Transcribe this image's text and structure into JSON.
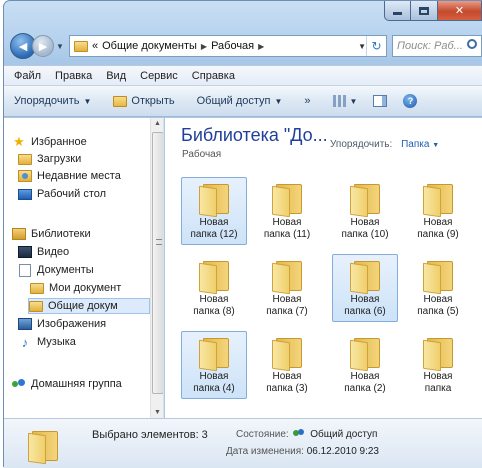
{
  "navigation": {
    "address_crumbs": [
      "«",
      "Общие документы",
      "Рабочая"
    ],
    "search_placeholder": "Поиск: Раб..."
  },
  "menu": [
    "Файл",
    "Правка",
    "Вид",
    "Сервис",
    "Справка"
  ],
  "toolbar": {
    "organize": "Упорядочить",
    "open": "Открыть",
    "share": "Общий доступ",
    "more": "»"
  },
  "sidebar": {
    "favorites": "Избранное",
    "downloads": "Загрузки",
    "recent": "Недавние места",
    "desktop": "Рабочий стол",
    "libraries": "Библиотеки",
    "video": "Видео",
    "documents": "Документы",
    "my_docs": "Мои документ",
    "shared_docs": "Общие докум",
    "images": "Изображения",
    "music": "Музыка",
    "homegroup": "Домашняя группа"
  },
  "library": {
    "title": "Библиотека \"До...",
    "subtitle": "Рабочая",
    "arrange_label": "Упорядочить:",
    "arrange_value": "Папка"
  },
  "folders": [
    {
      "line1": "Новая",
      "line2": "папка (12)",
      "selected": true
    },
    {
      "line1": "Новая",
      "line2": "папка (11)",
      "selected": false
    },
    {
      "line1": "Новая",
      "line2": "папка (10)",
      "selected": false
    },
    {
      "line1": "Новая",
      "line2": "папка (9)",
      "selected": false
    },
    {
      "line1": "Новая",
      "line2": "папка (8)",
      "selected": false
    },
    {
      "line1": "Новая",
      "line2": "папка (7)",
      "selected": false
    },
    {
      "line1": "Новая",
      "line2": "папка (6)",
      "selected": true
    },
    {
      "line1": "Новая",
      "line2": "папка (5)",
      "selected": false
    },
    {
      "line1": "Новая",
      "line2": "папка (4)",
      "selected": true
    },
    {
      "line1": "Новая",
      "line2": "папка (3)",
      "selected": false
    },
    {
      "line1": "Новая",
      "line2": "папка (2)",
      "selected": false
    },
    {
      "line1": "Новая",
      "line2": "папка",
      "selected": false
    }
  ],
  "status": {
    "selected": "Выбрано элементов: 3",
    "state_label": "Состояние:",
    "state_value": "Общий доступ",
    "date_label": "Дата изменения:",
    "date_value": "06.12.2010 9:23"
  }
}
